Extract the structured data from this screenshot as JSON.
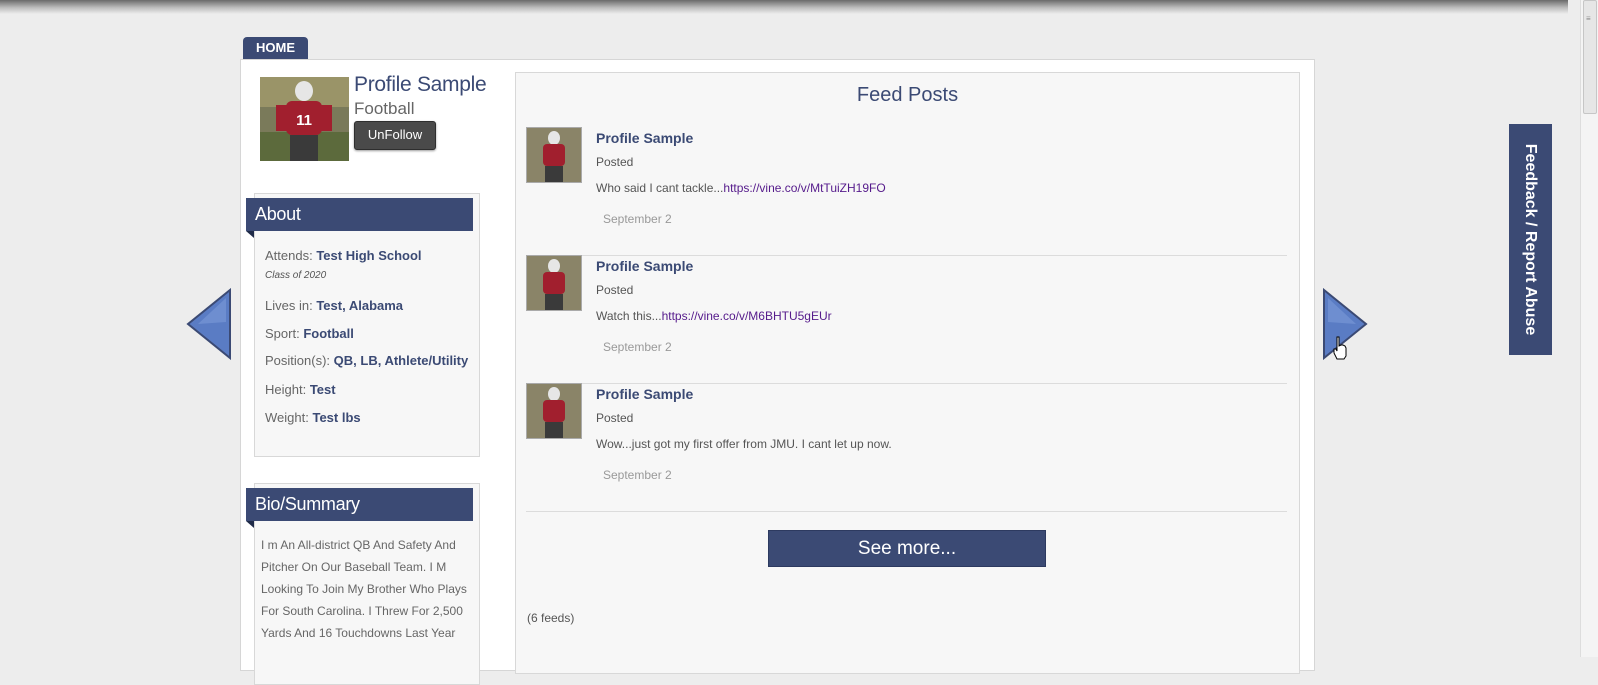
{
  "nav": {
    "home_label": "HOME"
  },
  "profile": {
    "name": "Profile Sample",
    "sport": "Football",
    "unfollow_label": "UnFollow"
  },
  "about": {
    "title": "About",
    "attends_label": "Attends:",
    "attends_value": "Test High School",
    "class_of": "Class of 2020",
    "lives_label": "Lives in:",
    "lives_value": "Test, Alabama",
    "sport_label": "Sport:",
    "sport_value": "Football",
    "positions_label": "Position(s):",
    "positions_value": "QB, LB, Athlete/Utility",
    "height_label": "Height:",
    "height_value": "Test",
    "weight_label": "Weight:",
    "weight_value": "Test lbs"
  },
  "bio": {
    "title": "Bio/Summary",
    "text": "I m An All-district QB And Safety And Pitcher On Our Baseball Team. I M Looking To Join My Brother Who Plays For South Carolina. I Threw For 2,500 Yards And 16 Touchdowns Last Year"
  },
  "feed": {
    "title": "Feed Posts",
    "posts": [
      {
        "author": "Profile Sample",
        "label": "Posted",
        "text": "Who said I cant tackle...",
        "link": "https://vine.co/v/MtTuiZH19FO",
        "date": "September 2"
      },
      {
        "author": "Profile Sample",
        "label": "Posted",
        "text": "Watch this...",
        "link": "https://vine.co/v/M6BHTU5gEUr",
        "date": "September 2"
      },
      {
        "author": "Profile Sample",
        "label": "Posted",
        "text": "Wow...just got my first offer from JMU. I cant let up now.",
        "link": "",
        "date": "September 2"
      }
    ],
    "see_more_label": "See more...",
    "count_label": "(6 feeds)"
  },
  "feedback": {
    "label": "Feedback / Report Abuse"
  },
  "icons": {
    "prev": "arrow-left-icon",
    "next": "arrow-right-icon",
    "cursor": "hand-cursor-icon"
  },
  "colors": {
    "brand": "#3b4a74",
    "link": "#551a8b",
    "background": "#ededed"
  }
}
